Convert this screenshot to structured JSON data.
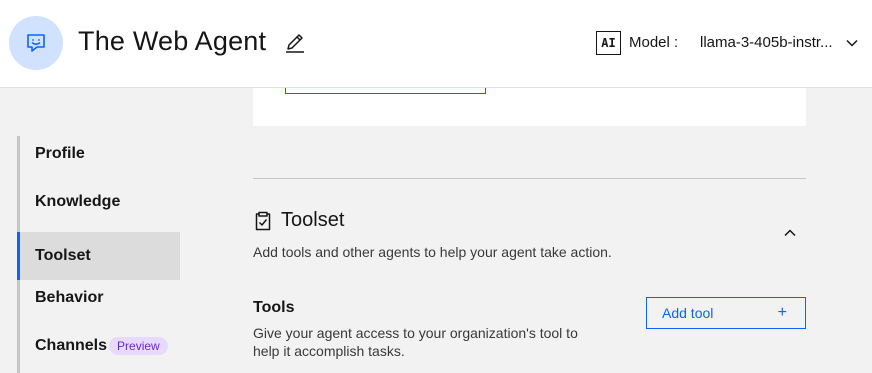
{
  "header": {
    "title": "The Web Agent",
    "model_badge": "AI",
    "model_label": "Model :",
    "model_value": "llama-3-405b-instr..."
  },
  "nav": {
    "items": [
      {
        "label": "Profile"
      },
      {
        "label": "Knowledge"
      },
      {
        "label": "Toolset",
        "active": true
      },
      {
        "label": "Behavior"
      },
      {
        "label": "Channels",
        "tag": "Preview"
      }
    ]
  },
  "toolset": {
    "title": "Toolset",
    "description": "Add tools and other agents to help your agent take action."
  },
  "tools": {
    "title": "Tools",
    "description": "Give your agent access to your organization's tool to help it accomplish tasks.",
    "add_label": "Add tool",
    "add_symbol": "+"
  },
  "colors": {
    "accent": "#0f62fe",
    "avatar_bg": "#d0e2ff",
    "preview_bg": "#e8daff",
    "preview_text": "#6929c4"
  }
}
